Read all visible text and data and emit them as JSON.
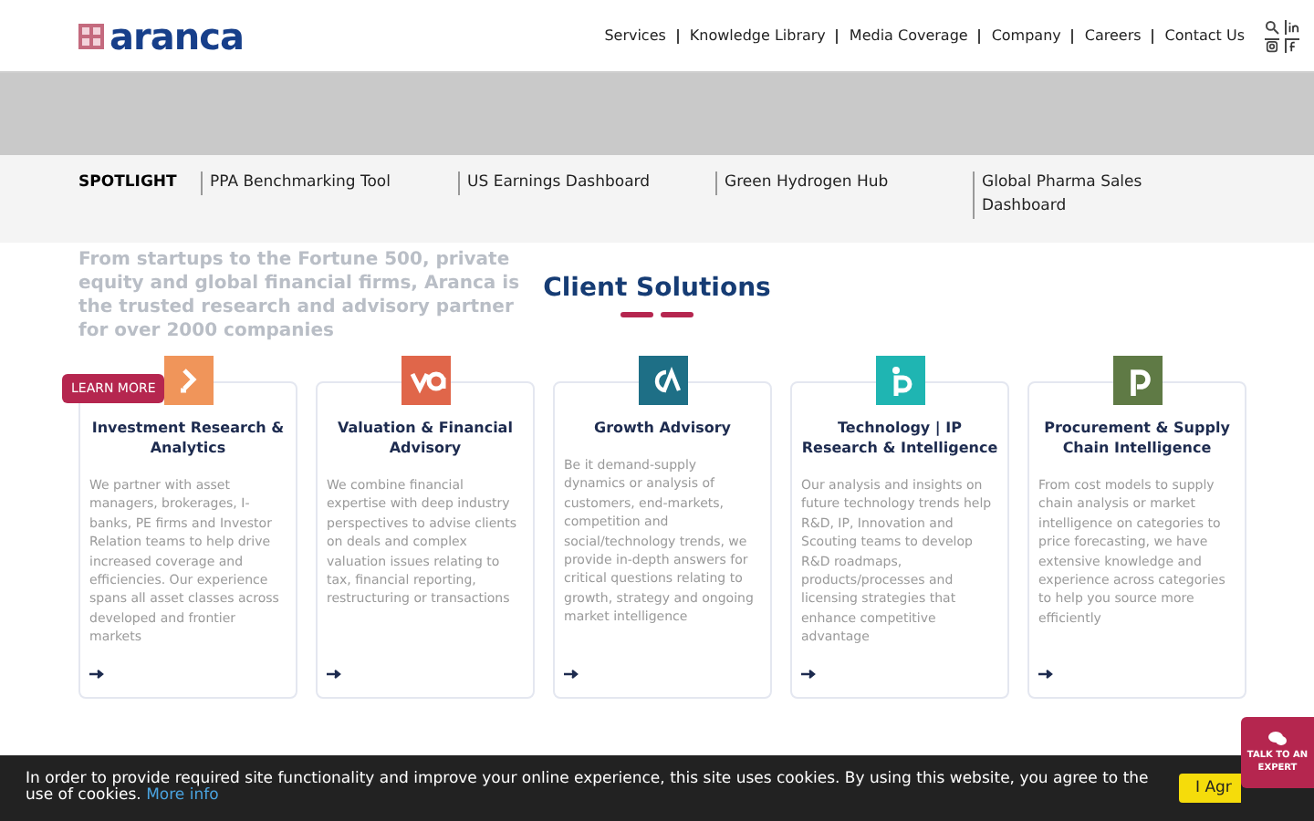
{
  "header": {
    "logo": "aranca",
    "nav": [
      "Services",
      "Knowledge Library",
      "Media Coverage",
      "Company",
      "Careers",
      "Contact Us"
    ]
  },
  "spotlight": {
    "label": "SPOTLIGHT",
    "items": [
      "PPA Benchmarking Tool",
      "US Earnings Dashboard",
      "Green Hydrogen Hub",
      "Global Pharma Sales Dashboard"
    ]
  },
  "hero": {
    "text": "From startups to the Fortune 500, private equity and global financial firms, Aranca is the trusted research and advisory partner for over 2000 companies",
    "button": "LEARN MORE"
  },
  "section_title": "Client Solutions",
  "cards": [
    {
      "kind": "arrow",
      "color": "#f0955a",
      "title": "Investment Research & Analytics",
      "text": "We partner with asset managers, brokerages, I-banks, PE firms and Investor Relation teams to help drive increased coverage and efficiencies. Our experience spans all asset classes across developed and frontier markets"
    },
    {
      "kind": "va",
      "color": "#e0664a",
      "title": "Valuation & Financial Advisory",
      "text": "We combine financial expertise with deep industry perspectives to advise clients on deals and complex valuation issues relating to tax, financial reporting, restructuring or transactions"
    },
    {
      "kind": "ga",
      "color": "#1e6f86",
      "title": "Growth Advisory",
      "text": "Be it demand-supply dynamics or analysis of customers, end-markets, competition and social/technology trends, we provide in-depth answers for critical questions relating to growth, strategy and ongoing market intelligence"
    },
    {
      "kind": "p",
      "color": "#1fb5b2",
      "title": "Technology | IP Research & Intelligence",
      "text": "Our analysis and insights on future technology trends help R&D, IP, Innovation and Scouting teams to develop R&D roadmaps, products/processes and licensing strategies that enhance competitive advantage"
    },
    {
      "kind": "p2",
      "color": "#5f7a45",
      "title": "Procurement & Supply Chain Intelligence",
      "text": "From cost models to supply chain analysis or market intelligence on categories to price forecasting, we have extensive knowledge and experience across categories to help you source more efficiently"
    }
  ],
  "cookie": {
    "text": "In order to provide required site functionality and improve your online experience, this site uses cookies. By using this website, you agree to the use of cookies.",
    "link": "More info",
    "button": "I Agr"
  },
  "expert_tab": {
    "label": "TALK TO AN EXPERT"
  }
}
